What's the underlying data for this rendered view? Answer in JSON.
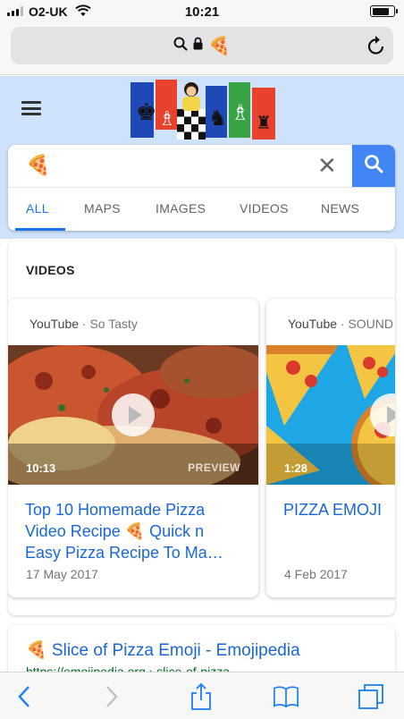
{
  "status_bar": {
    "carrier": "O2-UK",
    "time": "10:21",
    "battery_level": 0.8
  },
  "address_bar": {
    "url_text": "🍕",
    "icons": [
      "search-icon",
      "lock-icon",
      "reload-icon"
    ]
  },
  "header": {
    "menu_icon": "hamburger-icon",
    "doodle": "Google Doodle (chess)"
  },
  "search": {
    "query": "🍕",
    "clear_label": "✕",
    "submit_icon": "search-icon",
    "tabs": [
      {
        "label": "ALL",
        "active": true
      },
      {
        "label": "MAPS"
      },
      {
        "label": "IMAGES"
      },
      {
        "label": "VIDEOS"
      },
      {
        "label": "NEWS"
      }
    ]
  },
  "videos": {
    "section_title": "VIDEOS",
    "items": [
      {
        "source": "YouTube",
        "channel": "· So Tasty",
        "duration": "10:13",
        "preview_label": "PREVIEW",
        "title": "Top 10 Homemade Pizza Video Recipe 🍕 Quick n Easy Pizza Recipe To Ma…",
        "date": "17 May 2017"
      },
      {
        "source": "YouTube",
        "channel": "· SOUND E",
        "duration": "1:28",
        "title": "PIZZA EMOJI",
        "date": "4 Feb 2017"
      }
    ]
  },
  "results": [
    {
      "title": "🍕 Slice of Pizza Emoji - Emojipedia",
      "url": "https://emojipedia.org › slice-of-pizza"
    }
  ],
  "toolbar": {
    "icons": [
      "back-icon",
      "forward-icon",
      "share-icon",
      "bookmarks-icon",
      "tabs-icon"
    ]
  },
  "colors": {
    "accent": "#1a73e8",
    "search_button": "#4285f4",
    "header_background": "#cfe2fb",
    "link": "#1967d2"
  }
}
